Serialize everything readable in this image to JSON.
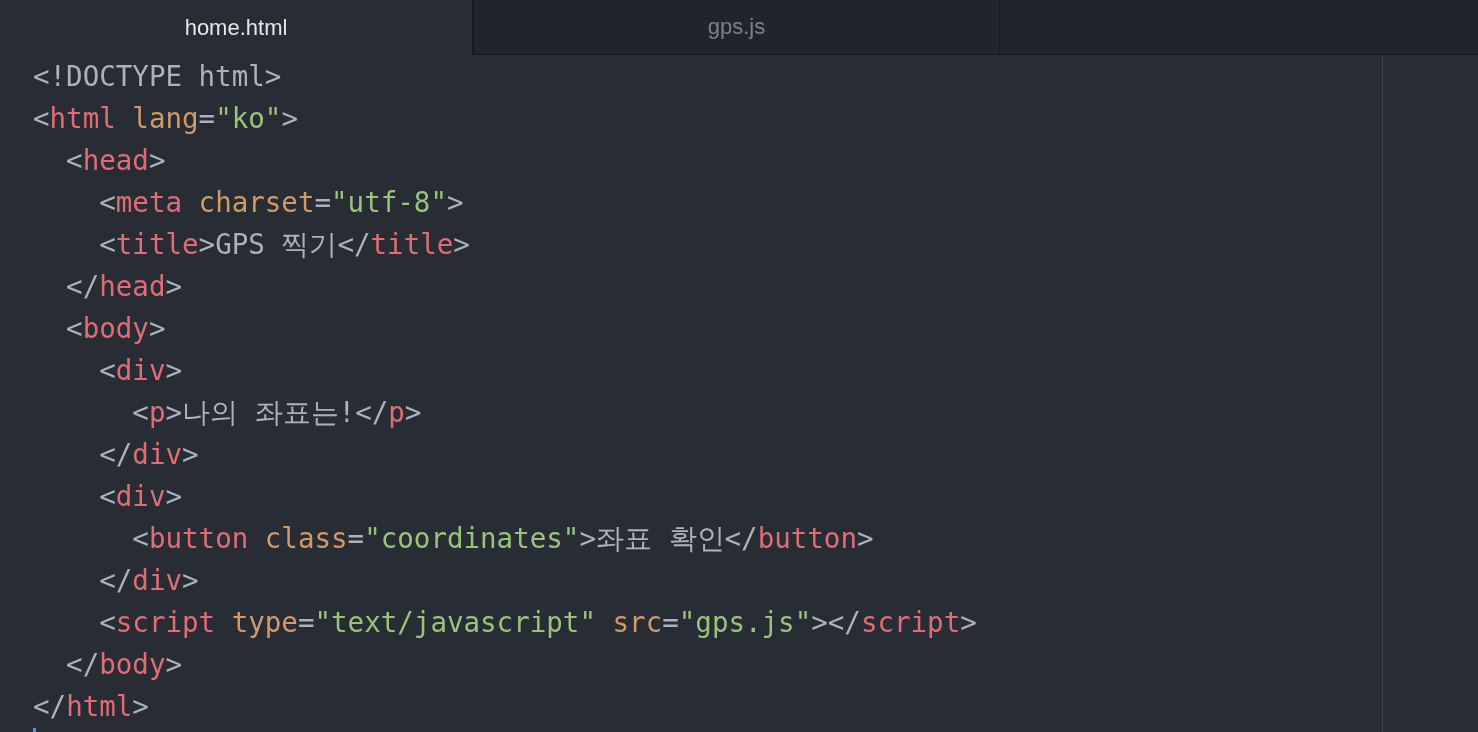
{
  "tabs": [
    {
      "label": "home.html",
      "selected": true
    },
    {
      "label": "gps.js",
      "selected": false
    }
  ],
  "lines": [
    [
      {
        "kind": "punct",
        "text": "<!DOCTYPE html>"
      }
    ],
    [
      {
        "kind": "punct",
        "text": "<"
      },
      {
        "kind": "tag",
        "text": "html"
      },
      {
        "kind": "attr",
        "text": " lang"
      },
      {
        "kind": "punct",
        "text": "="
      },
      {
        "kind": "string",
        "text": "\"ko\""
      },
      {
        "kind": "punct",
        "text": ">"
      }
    ],
    [
      {
        "kind": "punct",
        "text": "  <"
      },
      {
        "kind": "tag",
        "text": "head"
      },
      {
        "kind": "punct",
        "text": ">"
      }
    ],
    [
      {
        "kind": "punct",
        "text": "    <"
      },
      {
        "kind": "tag",
        "text": "meta"
      },
      {
        "kind": "attr",
        "text": " charset"
      },
      {
        "kind": "punct",
        "text": "="
      },
      {
        "kind": "string",
        "text": "\"utf-8\""
      },
      {
        "kind": "punct",
        "text": ">"
      }
    ],
    [
      {
        "kind": "punct",
        "text": "    <"
      },
      {
        "kind": "tag",
        "text": "title"
      },
      {
        "kind": "punct",
        "text": ">"
      },
      {
        "kind": "text",
        "text": "GPS 찍기"
      },
      {
        "kind": "punct",
        "text": "</"
      },
      {
        "kind": "tag",
        "text": "title"
      },
      {
        "kind": "punct",
        "text": ">"
      }
    ],
    [
      {
        "kind": "punct",
        "text": "  </"
      },
      {
        "kind": "tag",
        "text": "head"
      },
      {
        "kind": "punct",
        "text": ">"
      }
    ],
    [
      {
        "kind": "punct",
        "text": "  <"
      },
      {
        "kind": "tag",
        "text": "body"
      },
      {
        "kind": "punct",
        "text": ">"
      }
    ],
    [
      {
        "kind": "punct",
        "text": "    <"
      },
      {
        "kind": "tag",
        "text": "div"
      },
      {
        "kind": "punct",
        "text": ">"
      }
    ],
    [
      {
        "kind": "punct",
        "text": "      <"
      },
      {
        "kind": "tag",
        "text": "p"
      },
      {
        "kind": "punct",
        "text": ">"
      },
      {
        "kind": "text",
        "text": "나의 좌표는!"
      },
      {
        "kind": "punct",
        "text": "</"
      },
      {
        "kind": "tag",
        "text": "p"
      },
      {
        "kind": "punct",
        "text": ">"
      }
    ],
    [
      {
        "kind": "punct",
        "text": "    </"
      },
      {
        "kind": "tag",
        "text": "div"
      },
      {
        "kind": "punct",
        "text": ">"
      }
    ],
    [
      {
        "kind": "punct",
        "text": "    <"
      },
      {
        "kind": "tag",
        "text": "div"
      },
      {
        "kind": "punct",
        "text": ">"
      }
    ],
    [
      {
        "kind": "punct",
        "text": "      <"
      },
      {
        "kind": "tag",
        "text": "button"
      },
      {
        "kind": "attr",
        "text": " class"
      },
      {
        "kind": "punct",
        "text": "="
      },
      {
        "kind": "string",
        "text": "\"coordinates\""
      },
      {
        "kind": "punct",
        "text": ">"
      },
      {
        "kind": "text",
        "text": "좌표 확인"
      },
      {
        "kind": "punct",
        "text": "</"
      },
      {
        "kind": "tag",
        "text": "button"
      },
      {
        "kind": "punct",
        "text": ">"
      }
    ],
    [
      {
        "kind": "punct",
        "text": "    </"
      },
      {
        "kind": "tag",
        "text": "div"
      },
      {
        "kind": "punct",
        "text": ">"
      }
    ],
    [
      {
        "kind": "punct",
        "text": "    <"
      },
      {
        "kind": "tag",
        "text": "script"
      },
      {
        "kind": "attr",
        "text": " type"
      },
      {
        "kind": "punct",
        "text": "="
      },
      {
        "kind": "string",
        "text": "\"text/javascript\""
      },
      {
        "kind": "attr",
        "text": " src"
      },
      {
        "kind": "punct",
        "text": "="
      },
      {
        "kind": "string",
        "text": "\"gps.js\""
      },
      {
        "kind": "punct",
        "text": "></"
      },
      {
        "kind": "tag",
        "text": "script"
      },
      {
        "kind": "punct",
        "text": ">"
      }
    ],
    [
      {
        "kind": "punct",
        "text": "  </"
      },
      {
        "kind": "tag",
        "text": "body"
      },
      {
        "kind": "punct",
        "text": ">"
      }
    ],
    [
      {
        "kind": "punct",
        "text": "</"
      },
      {
        "kind": "tag",
        "text": "html"
      },
      {
        "kind": "punct",
        "text": ">"
      }
    ]
  ]
}
